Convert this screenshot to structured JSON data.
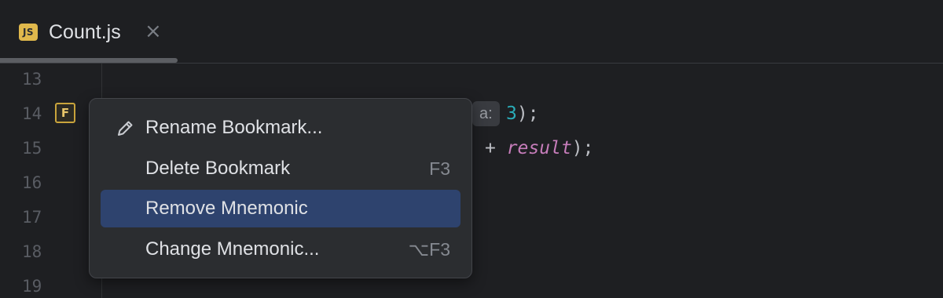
{
  "tab": {
    "icon_text": "JS",
    "icon": "js-file-icon",
    "title": "Count.js",
    "close_glyph": "×"
  },
  "gutter": {
    "line_numbers": [
      "13",
      "14",
      "15",
      "16",
      "17",
      "18",
      "19"
    ],
    "bookmark_mnemonic": "F"
  },
  "code": {
    "line14": {
      "hint": "a:",
      "number": "3",
      "tail": ");"
    },
    "line15": {
      "lead": "+ ",
      "variable": "result",
      "tail": ");"
    }
  },
  "context_menu": {
    "items": [
      {
        "label": "Rename Bookmark...",
        "shortcut": "",
        "icon": "pencil-icon"
      },
      {
        "label": "Delete Bookmark",
        "shortcut": "F3",
        "icon": ""
      },
      {
        "label": "Remove Mnemonic",
        "shortcut": "",
        "icon": "",
        "selected": true
      },
      {
        "label": "Change Mnemonic...",
        "shortcut": "⌥F3",
        "icon": ""
      }
    ]
  },
  "colors": {
    "background": "#1e1f22",
    "menu_background": "#2b2d30",
    "selection": "#2e436e",
    "bookmark": "#c9a43c",
    "number": "#2aacb8",
    "variable": "#c77dbb"
  }
}
